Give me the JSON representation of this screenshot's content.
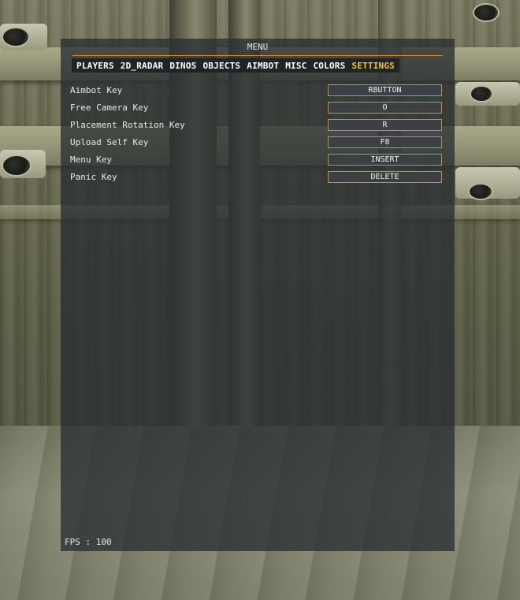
{
  "menu": {
    "title": "MENU",
    "tabs": [
      {
        "label": "PLAYERS",
        "active": false
      },
      {
        "label": "2D_RADAR",
        "active": false
      },
      {
        "label": "DINOS",
        "active": false
      },
      {
        "label": "OBJECTS",
        "active": false
      },
      {
        "label": "AIMBOT",
        "active": false
      },
      {
        "label": "MISC",
        "active": false
      },
      {
        "label": "COLORS",
        "active": false
      },
      {
        "label": "SETTINGS",
        "active": true
      }
    ],
    "settings": [
      {
        "label": "Aimbot Key",
        "value": "RBUTTON"
      },
      {
        "label": "Free Camera Key",
        "value": "O"
      },
      {
        "label": "Placement Rotation Key",
        "value": "R"
      },
      {
        "label": "Upload Self Key",
        "value": "F8"
      },
      {
        "label": "Menu Key",
        "value": "INSERT"
      },
      {
        "label": "Panic Key",
        "value": "DELETE"
      }
    ],
    "fps": "FPS : 100"
  },
  "colors": {
    "accent": "#d68a2a",
    "active_tab": "#f2c230",
    "panel_bg": "#2a3032"
  }
}
